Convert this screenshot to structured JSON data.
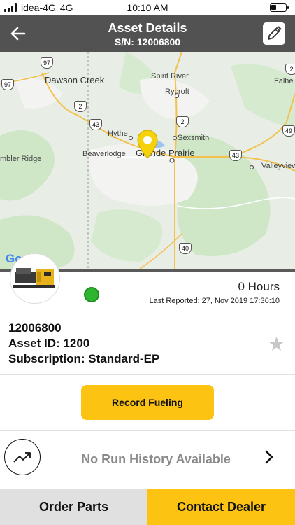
{
  "status_bar": {
    "carrier": "idea-4G",
    "network": "4G",
    "time": "10:10 AM"
  },
  "header": {
    "title": "Asset Details",
    "serial": "S/N: 12006800",
    "back_icon": "arrow-left-icon",
    "edit_icon": "edit-pencil-icon"
  },
  "map": {
    "labels": [
      "Dawson Creek",
      "Spirit River",
      "Rycroft",
      "Falhe",
      "Hythe",
      "Sexsmith",
      "Beaverlodge",
      "Grande Prairie",
      "mbler Ridge",
      "Valleyview"
    ],
    "highways": [
      "97",
      "97",
      "2",
      "43",
      "2",
      "43",
      "49",
      "2",
      "40"
    ],
    "attribution": "Google",
    "pin_color": "#f5d20a"
  },
  "asset": {
    "hours": "0 Hours",
    "last_reported": "Last Reported: 27, Nov 2019 17:36:10",
    "status_color": "#2fb52f",
    "serial_number": "12006800",
    "asset_id": "Asset ID: 1200",
    "subscription": "Subscription: Standard-EP"
  },
  "actions": {
    "record_fueling": "Record Fueling",
    "no_run_history": "No Run History Available",
    "order_parts": "Order Parts",
    "contact_dealer": "Contact Dealer"
  },
  "colors": {
    "accent": "#fcc312",
    "header": "#525252"
  }
}
